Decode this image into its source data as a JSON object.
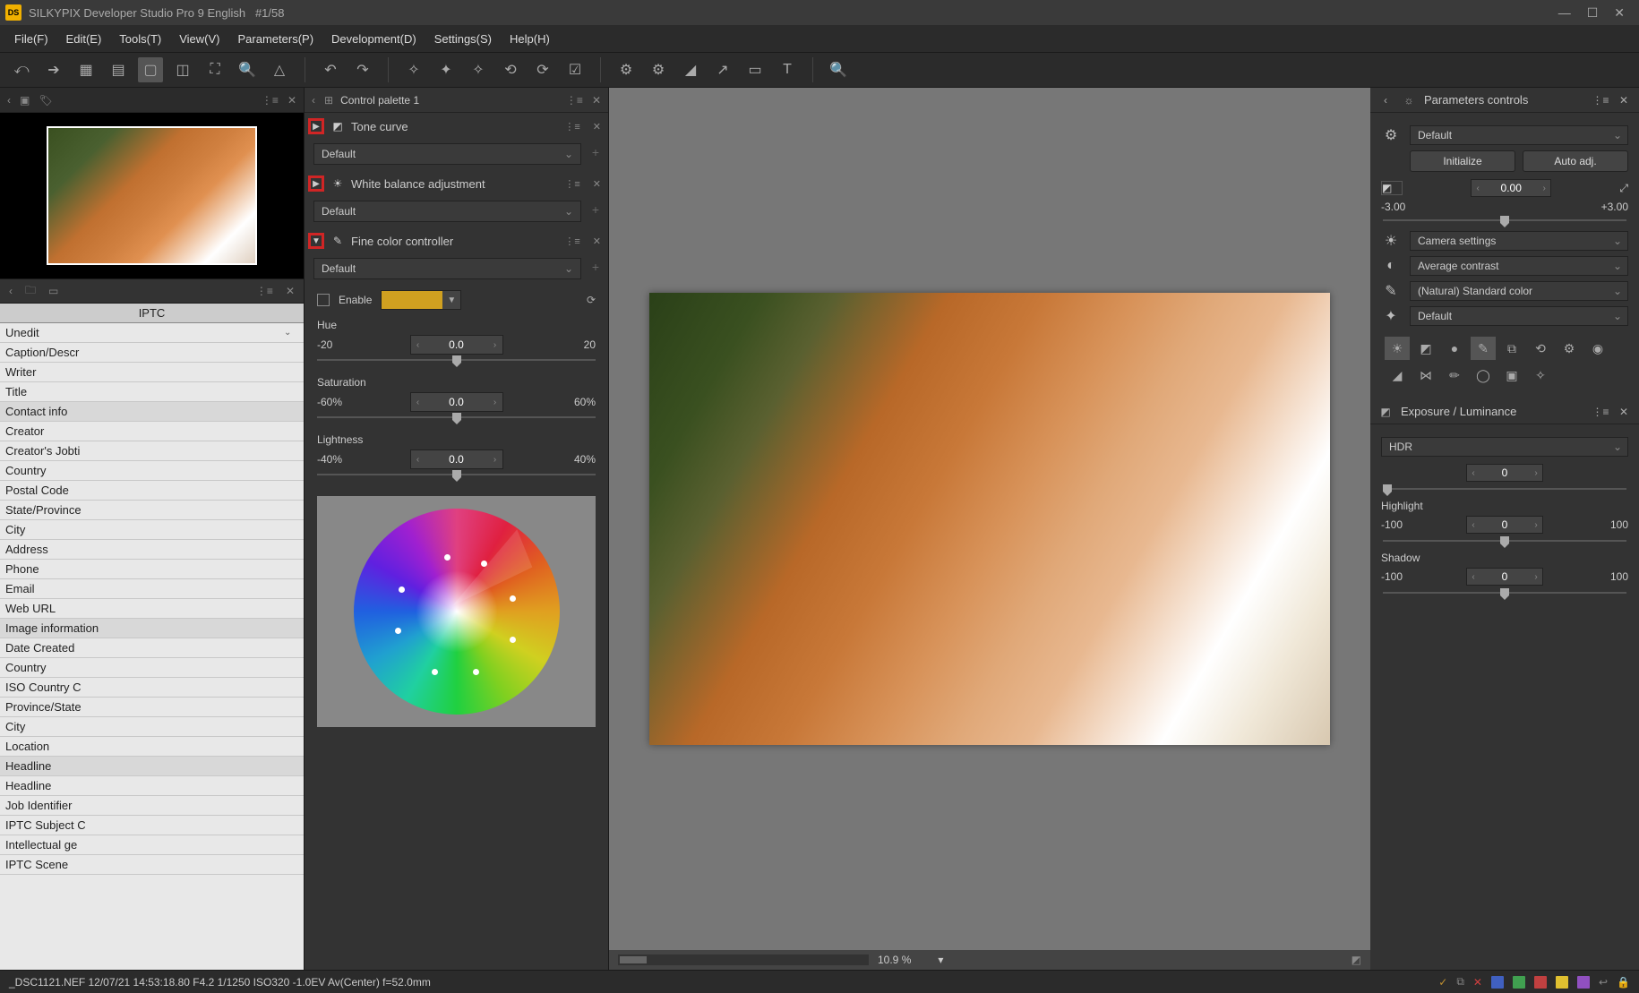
{
  "titlebar": {
    "app": "SILKYPIX Developer Studio Pro 9 English",
    "counter": "#1/58"
  },
  "menu": [
    "File(F)",
    "Edit(E)",
    "Tools(T)",
    "View(V)",
    "Parameters(P)",
    "Development(D)",
    "Settings(S)",
    "Help(H)"
  ],
  "left": {
    "iptc_header": "IPTC",
    "rows": [
      {
        "t": "Unedit",
        "sel": true
      },
      {
        "t": "Caption/Descr"
      },
      {
        "t": "Writer"
      },
      {
        "t": "Title"
      },
      {
        "t": "Contact info",
        "g": true
      },
      {
        "t": "Creator"
      },
      {
        "t": "Creator's Jobti"
      },
      {
        "t": "Country"
      },
      {
        "t": "Postal Code"
      },
      {
        "t": "State/Province"
      },
      {
        "t": "City"
      },
      {
        "t": "Address"
      },
      {
        "t": "Phone"
      },
      {
        "t": "Email"
      },
      {
        "t": "Web URL"
      },
      {
        "t": "Image information",
        "g": true
      },
      {
        "t": "Date Created"
      },
      {
        "t": "Country"
      },
      {
        "t": "ISO Country C"
      },
      {
        "t": "Province/State"
      },
      {
        "t": "City"
      },
      {
        "t": "Location"
      },
      {
        "t": "Headline",
        "g": true
      },
      {
        "t": "Headline"
      },
      {
        "t": "Job Identifier"
      },
      {
        "t": "IPTC Subject C"
      },
      {
        "t": "Intellectual ge"
      },
      {
        "t": "IPTC Scene"
      }
    ]
  },
  "mid": {
    "palette_title": "Control palette 1",
    "tone": {
      "title": "Tone curve",
      "preset": "Default"
    },
    "wb": {
      "title": "White balance adjustment",
      "preset": "Default"
    },
    "fine": {
      "title": "Fine color controller",
      "preset": "Default",
      "enable_label": "Enable",
      "hue": {
        "label": "Hue",
        "min": "-20",
        "max": "20",
        "val": "0.0"
      },
      "sat": {
        "label": "Saturation",
        "min": "-60%",
        "max": "60%",
        "val": "0.0"
      },
      "light": {
        "label": "Lightness",
        "min": "-40%",
        "max": "40%",
        "val": "0.0"
      }
    }
  },
  "center": {
    "zoom": "10.9  %",
    "zoom_unit": "▾"
  },
  "right": {
    "header": "Parameters controls",
    "preset": "Default",
    "init_btn": "Initialize",
    "auto_btn": "Auto adj.",
    "exposure": {
      "val": "0.00",
      "min": "-3.00",
      "max": "+3.00"
    },
    "dd_wb": "Camera settings",
    "dd_contrast": "Average contrast",
    "dd_color": "(Natural) Standard color",
    "dd_sharp": "Default",
    "luminance_hdr_title": "Exposure / Luminance",
    "hdr": {
      "label": "HDR",
      "val": "0"
    },
    "highlight": {
      "label": "Highlight",
      "min": "-100",
      "max": "100",
      "val": "0"
    },
    "shadow": {
      "label": "Shadow",
      "min": "-100",
      "max": "100",
      "val": "0"
    }
  },
  "status": "_DSC1121.NEF 12/07/21 14:53:18.80 F4.2 1/1250 ISO320 -1.0EV Av(Center) f=52.0mm"
}
